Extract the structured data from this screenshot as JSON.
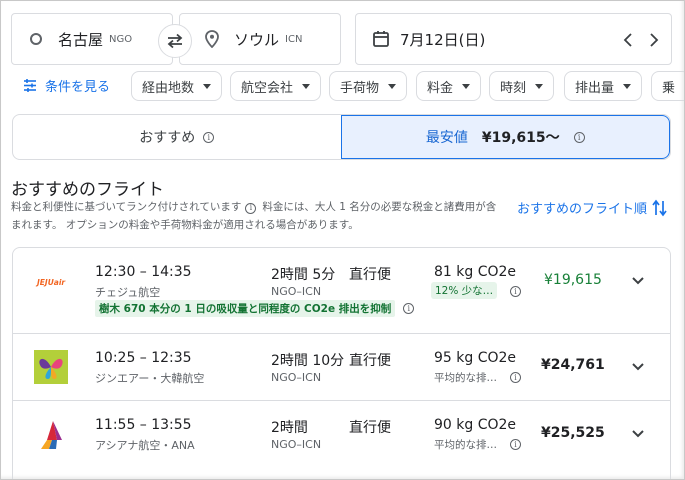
{
  "search": {
    "origin_city": "名古屋",
    "origin_code": "NGO",
    "destination_city": "ソウル",
    "destination_code": "ICN",
    "date": "7月12日(日)"
  },
  "filters": {
    "all_filters": "条件を見る",
    "chips": [
      "経由地数",
      "航空会社",
      "手荷物",
      "料金",
      "時刻",
      "排出量",
      "乗"
    ]
  },
  "sort_tabs": {
    "recommended": "おすすめ",
    "cheapest": "最安値",
    "cheapest_price": "¥19,615～"
  },
  "section": {
    "title": "おすすめのフライト",
    "description_1": "料金と利便性に基づいてランク付けされています",
    "description_2": "料金には、大人 1 名分の必要な税金と諸費用が含まれます。 オプションの料金や手荷物料金が適用される場合があります。",
    "sort_label": "おすすめのフライト順"
  },
  "flights": [
    {
      "times": "12:30 – 14:35",
      "airline": "チェジュ航空",
      "duration": "2時間 5分",
      "route": "NGO–ICN",
      "stops": "直行便",
      "co2": "81 kg CO2e",
      "co2_note": "12% 少な…",
      "price": "¥19,615",
      "tree_note": "樹木 670 本分の 1 日の吸収量と同程度の CO2e 排出を抑制",
      "logo": "jejuair-logo"
    },
    {
      "times": "10:25 – 12:35",
      "airline": "ジンエアー・大韓航空",
      "duration": "2時間 10分",
      "route": "NGO–ICN",
      "stops": "直行便",
      "co2": "95 kg CO2e",
      "co2_note": "平均的な排…",
      "price": "¥24,761",
      "logo": "jinair-logo"
    },
    {
      "times": "11:55 – 13:55",
      "airline": "アシアナ航空・ANA",
      "duration": "2時間",
      "route": "NGO–ICN",
      "stops": "直行便",
      "co2": "90 kg CO2e",
      "co2_note": "平均的な排…",
      "price": "¥25,525",
      "logo": "asiana-logo"
    }
  ],
  "colors": {
    "accent": "#1a73e8",
    "green": "#188038",
    "active_tab_bg": "#e8f0fe",
    "border": "#dadce0"
  }
}
